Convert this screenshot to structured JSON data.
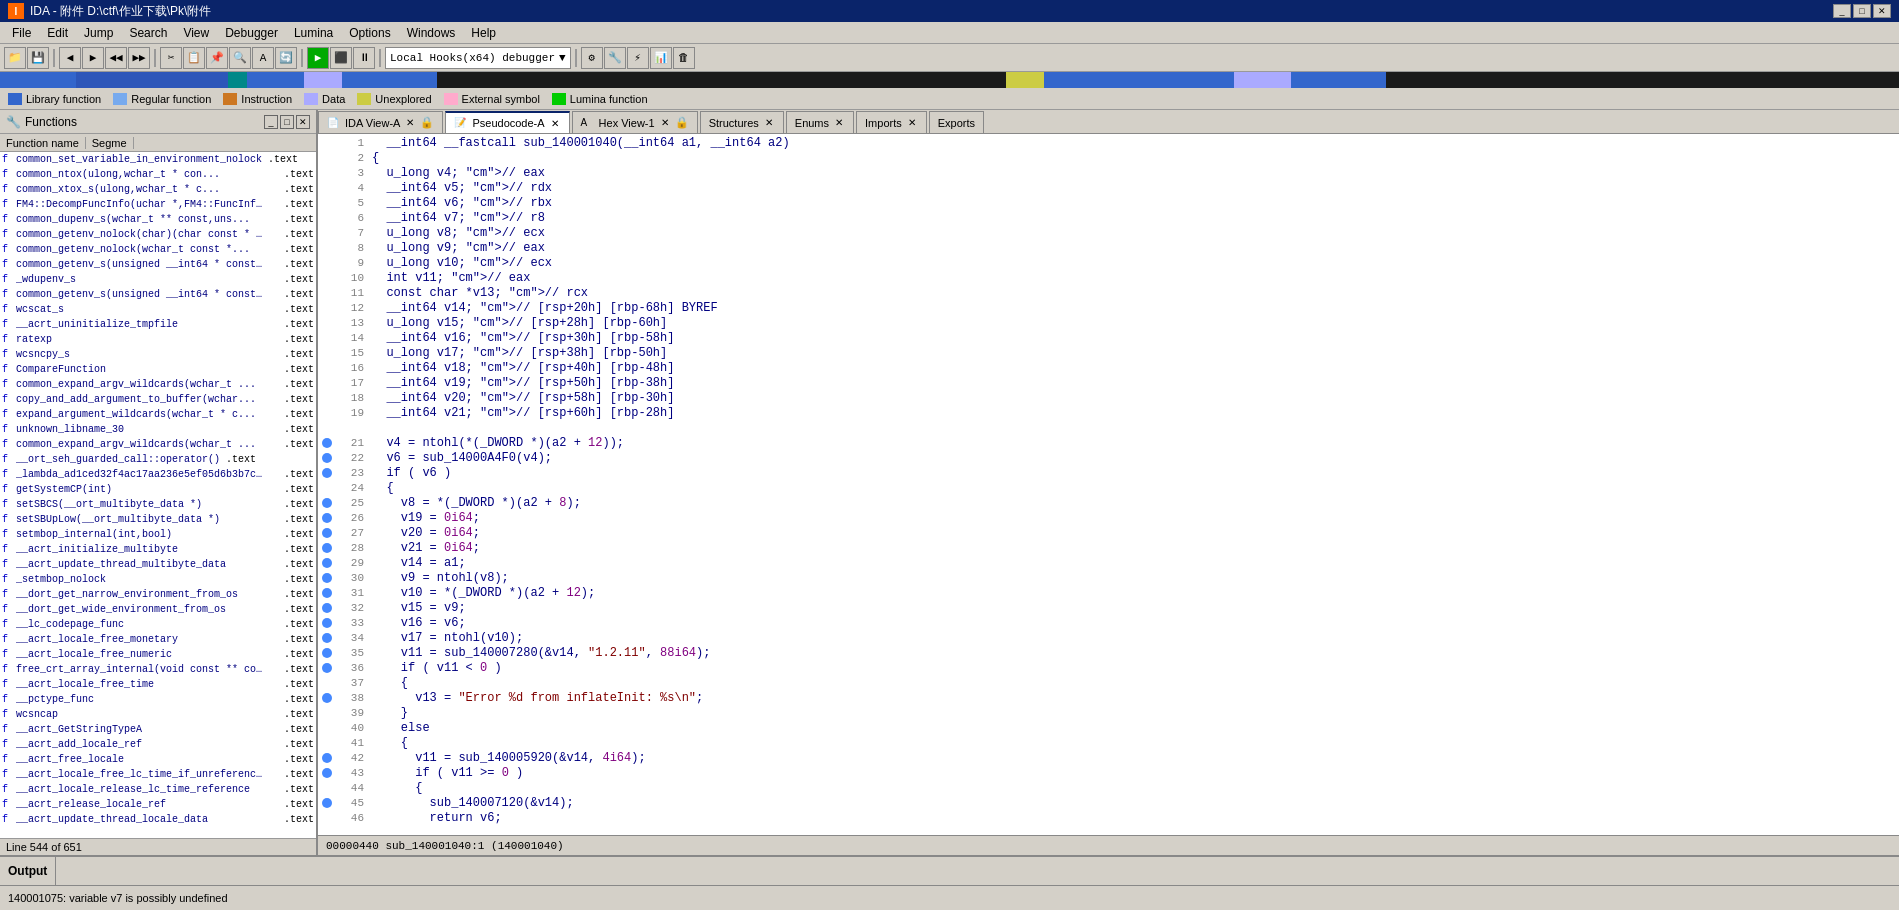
{
  "titleBar": {
    "title": "IDA - 附件 D:\\ctf\\作业下载\\Pk\\附件",
    "icon": "I",
    "controls": [
      "_",
      "□",
      "✕"
    ]
  },
  "menuBar": {
    "items": [
      "File",
      "Edit",
      "Jump",
      "Search",
      "View",
      "Debugger",
      "Lumina",
      "Options",
      "Windows",
      "Help"
    ]
  },
  "legend": {
    "items": [
      {
        "color": "#3366cc",
        "label": "Library function"
      },
      {
        "color": "#66aaff",
        "label": "Regular function"
      },
      {
        "color": "#cc6600",
        "label": "Instruction"
      },
      {
        "color": "#aaaaff",
        "label": "Data"
      },
      {
        "color": "#cccc00",
        "label": "Unexplored"
      },
      {
        "color": "#ffaacc",
        "label": "External symbol"
      },
      {
        "color": "#00cc00",
        "label": "Lumina function"
      }
    ]
  },
  "functionsPanel": {
    "title": "Functions",
    "columns": [
      "Function name",
      "Segme"
    ],
    "statusLine": "Line 544 of 651",
    "functions": [
      {
        "icon": "f",
        "name": "common_set_variable_in_environment_nolock<wchar...",
        "seg": ".text"
      },
      {
        "icon": "f",
        "name": "common_ntox<ulong,wchar_t>(ulong,wchar_t * con...",
        "seg": ".text"
      },
      {
        "icon": "f",
        "name": "common_xtox_s<ulong,wchar_t>(ulong,wchar_t * c...",
        "seg": ".text"
      },
      {
        "icon": "f",
        "name": "FM4::DecompFuncInfo(uchar *,FM4::FuncInfo4 & u...",
        "seg": ".text"
      },
      {
        "icon": "f",
        "name": "common_dupenv_s<wchar_t>(wchar_t ** const,uns...",
        "seg": ".text"
      },
      {
        "icon": "f",
        "name": "common_getenv_nolock(char)(char const * const)",
        "seg": ".text"
      },
      {
        "icon": "f",
        "name": "common_getenv_nolock<wchar_t>(wchar_t const *...",
        "seg": ".text"
      },
      {
        "icon": "f",
        "name": "common_getenv_s<char>(unsigned __int64 * const...",
        "seg": ".text"
      },
      {
        "icon": "f",
        "name": "_wdupenv_s",
        "seg": ".text"
      },
      {
        "icon": "f",
        "name": "common_getenv_s<char>(unsigned __int64 * const...",
        "seg": ".text"
      },
      {
        "icon": "f",
        "name": "wcscat_s",
        "seg": ".text"
      },
      {
        "icon": "f",
        "name": "__acrt_uninitialize_tmpfile",
        "seg": ".text"
      },
      {
        "icon": "f",
        "name": "ratexp",
        "seg": ".text"
      },
      {
        "icon": "f",
        "name": "wcsncpy_s",
        "seg": ".text"
      },
      {
        "icon": "f",
        "name": "CompareFunction",
        "seg": ".text"
      },
      {
        "icon": "f",
        "name": "common_expand_argv_wildcards<wchar_t>(wchar_t ...",
        "seg": ".text"
      },
      {
        "icon": "f",
        "name": "copy_and_add_argument_to_buffer<wchar_t>(wchar...",
        "seg": ".text"
      },
      {
        "icon": "f",
        "name": "expand_argument_wildcards<wchar_t>(wchar_t * c...",
        "seg": ".text"
      },
      {
        "icon": "f",
        "name": "unknown_libname_30",
        "seg": ".text"
      },
      {
        "icon": "f",
        "name": "common_expand_argv_wildcards<wchar_t>(wchar_t ...",
        "seg": ".text"
      },
      {
        "icon": "f",
        "name": "__ort_seh_guarded_call<void>::operator()<lamb...",
        "seg": ".text"
      },
      {
        "icon": "f",
        "name": "_lambda_ad1ced32f4ac17aa236e5ef05d6b3b7c_::ope...",
        "seg": ".text"
      },
      {
        "icon": "f",
        "name": "getSystemCP(int)",
        "seg": ".text"
      },
      {
        "icon": "f",
        "name": "setSBCS(__ort_multibyte_data *)",
        "seg": ".text"
      },
      {
        "icon": "f",
        "name": "setSBUpLow(__ort_multibyte_data *)",
        "seg": ".text"
      },
      {
        "icon": "f",
        "name": "setmbop_internal(int,bool)",
        "seg": ".text"
      },
      {
        "icon": "f",
        "name": "__acrt_initialize_multibyte",
        "seg": ".text"
      },
      {
        "icon": "f",
        "name": "__acrt_update_thread_multibyte_data",
        "seg": ".text"
      },
      {
        "icon": "f",
        "name": "_setmbop_nolock",
        "seg": ".text"
      },
      {
        "icon": "f",
        "name": "__dort_get_narrow_environment_from_os",
        "seg": ".text"
      },
      {
        "icon": "f",
        "name": "__dort_get_wide_environment_from_os",
        "seg": ".text"
      },
      {
        "icon": "f",
        "name": "__lc_codepage_func",
        "seg": ".text"
      },
      {
        "icon": "f",
        "name": "__acrt_locale_free_monetary",
        "seg": ".text"
      },
      {
        "icon": "f",
        "name": "__acrt_locale_free_numeric",
        "seg": ".text"
      },
      {
        "icon": "f",
        "name": "free_crt_array_internal(void const ** const,u...",
        "seg": ".text"
      },
      {
        "icon": "f",
        "name": "__acrt_locale_free_time",
        "seg": ".text"
      },
      {
        "icon": "f",
        "name": "__pctype_func",
        "seg": ".text"
      },
      {
        "icon": "f",
        "name": "wcsncap",
        "seg": ".text"
      },
      {
        "icon": "f",
        "name": "__acrt_GetStringTypeA",
        "seg": ".text"
      },
      {
        "icon": "f",
        "name": "__acrt_add_locale_ref",
        "seg": ".text"
      },
      {
        "icon": "f",
        "name": "__acrt_free_locale",
        "seg": ".text"
      },
      {
        "icon": "f",
        "name": "__acrt_locale_free_lc_time_if_unreferenced",
        "seg": ".text"
      },
      {
        "icon": "f",
        "name": "__acrt_locale_release_lc_time_reference",
        "seg": ".text"
      },
      {
        "icon": "f",
        "name": "__acrt_release_locale_ref",
        "seg": ".text"
      },
      {
        "icon": "f",
        "name": "__acrt_update_thread_locale_data",
        "seg": ".text"
      }
    ]
  },
  "tabs": [
    {
      "id": "ida-view-a",
      "label": "IDA View-A",
      "active": false,
      "closeable": true
    },
    {
      "id": "pseudocode-a",
      "label": "Pseudocode-A",
      "active": true,
      "closeable": true
    },
    {
      "id": "hex-view-1",
      "label": "Hex View-1",
      "active": false,
      "closeable": true
    },
    {
      "id": "structures",
      "label": "Structures",
      "active": false,
      "closeable": true
    },
    {
      "id": "enums",
      "label": "Enums",
      "active": false,
      "closeable": true
    },
    {
      "id": "imports",
      "label": "Imports",
      "active": false,
      "closeable": true
    },
    {
      "id": "exports",
      "label": "Exports",
      "active": false,
      "closeable": false
    }
  ],
  "codeView": {
    "lines": [
      {
        "num": 1,
        "dot": false,
        "code": "  __int64 __fastcall sub_140001040(__int64 a1, __int64 a2)"
      },
      {
        "num": 2,
        "dot": false,
        "code": "{"
      },
      {
        "num": 3,
        "dot": false,
        "code": "  u_long v4; // eax"
      },
      {
        "num": 4,
        "dot": false,
        "code": "  __int64 v5; // rdx"
      },
      {
        "num": 5,
        "dot": false,
        "code": "  __int64 v6; // rbx"
      },
      {
        "num": 6,
        "dot": false,
        "code": "  __int64 v7; // r8"
      },
      {
        "num": 7,
        "dot": false,
        "code": "  u_long v8; // ecx"
      },
      {
        "num": 8,
        "dot": false,
        "code": "  u_long v9; // eax"
      },
      {
        "num": 9,
        "dot": false,
        "code": "  u_long v10; // ecx"
      },
      {
        "num": 10,
        "dot": false,
        "code": "  int v11; // eax"
      },
      {
        "num": 11,
        "dot": false,
        "code": "  const char *v13; // rcx"
      },
      {
        "num": 12,
        "dot": false,
        "code": "  __int64 v14; // [rsp+20h] [rbp-68h] BYREF"
      },
      {
        "num": 13,
        "dot": false,
        "code": "  u_long v15; // [rsp+28h] [rbp-60h]"
      },
      {
        "num": 14,
        "dot": false,
        "code": "  __int64 v16; // [rsp+30h] [rbp-58h]"
      },
      {
        "num": 15,
        "dot": false,
        "code": "  u_long v17; // [rsp+38h] [rbp-50h]"
      },
      {
        "num": 16,
        "dot": false,
        "code": "  __int64 v18; // [rsp+40h] [rbp-48h]"
      },
      {
        "num": 17,
        "dot": false,
        "code": "  __int64 v19; // [rsp+50h] [rbp-38h]"
      },
      {
        "num": 18,
        "dot": false,
        "code": "  __int64 v20; // [rsp+58h] [rbp-30h]"
      },
      {
        "num": 19,
        "dot": false,
        "code": "  __int64 v21; // [rsp+60h] [rbp-28h]"
      },
      {
        "num": 20,
        "dot": false,
        "code": ""
      },
      {
        "num": 21,
        "dot": true,
        "code": "  v4 = ntohl(*(_DWORD *)(a2 + 12));"
      },
      {
        "num": 22,
        "dot": true,
        "code": "  v6 = sub_14000A4F0(v4);"
      },
      {
        "num": 23,
        "dot": true,
        "code": "  if ( v6 )"
      },
      {
        "num": 24,
        "dot": false,
        "code": "  {"
      },
      {
        "num": 25,
        "dot": true,
        "code": "    v8 = *(_DWORD *)(a2 + 8);"
      },
      {
        "num": 26,
        "dot": true,
        "code": "    v19 = 0i64;"
      },
      {
        "num": 27,
        "dot": true,
        "code": "    v20 = 0i64;"
      },
      {
        "num": 28,
        "dot": true,
        "code": "    v21 = 0i64;"
      },
      {
        "num": 29,
        "dot": true,
        "code": "    v14 = a1;"
      },
      {
        "num": 30,
        "dot": true,
        "code": "    v9 = ntohl(v8);"
      },
      {
        "num": 31,
        "dot": true,
        "code": "    v10 = *(_DWORD *)(a2 + 12);"
      },
      {
        "num": 32,
        "dot": true,
        "code": "    v15 = v9;"
      },
      {
        "num": 33,
        "dot": true,
        "code": "    v16 = v6;"
      },
      {
        "num": 34,
        "dot": true,
        "code": "    v17 = ntohl(v10);"
      },
      {
        "num": 35,
        "dot": true,
        "code": "    v11 = sub_140007280(&v14, \"1.2.11\", 88i64);"
      },
      {
        "num": 36,
        "dot": true,
        "code": "    if ( v11 < 0 )"
      },
      {
        "num": 37,
        "dot": false,
        "code": "    {"
      },
      {
        "num": 38,
        "dot": true,
        "code": "      v13 = \"Error %d from inflateInit: %s\\n\";"
      },
      {
        "num": 39,
        "dot": false,
        "code": "    }"
      },
      {
        "num": 40,
        "dot": false,
        "code": "    else"
      },
      {
        "num": 41,
        "dot": false,
        "code": "    {"
      },
      {
        "num": 42,
        "dot": true,
        "code": "      v11 = sub_140005920(&v14, 4i64);"
      },
      {
        "num": 43,
        "dot": true,
        "code": "      if ( v11 >= 0 )"
      },
      {
        "num": 44,
        "dot": false,
        "code": "      {"
      },
      {
        "num": 45,
        "dot": true,
        "code": "        sub_140007120(&v14);"
      },
      {
        "num": 46,
        "dot": false,
        "code": "        return v6;"
      }
    ]
  },
  "addrBar": {
    "text": "00000440 sub_140001040:1 (140001040)"
  },
  "outputPanel": {
    "title": "Output"
  },
  "statusBar": {
    "text": "140001075: variable v7 is possibly undefined"
  },
  "toolbar": {
    "debuggerDropdown": "Local Hooks(x64) debugger"
  }
}
